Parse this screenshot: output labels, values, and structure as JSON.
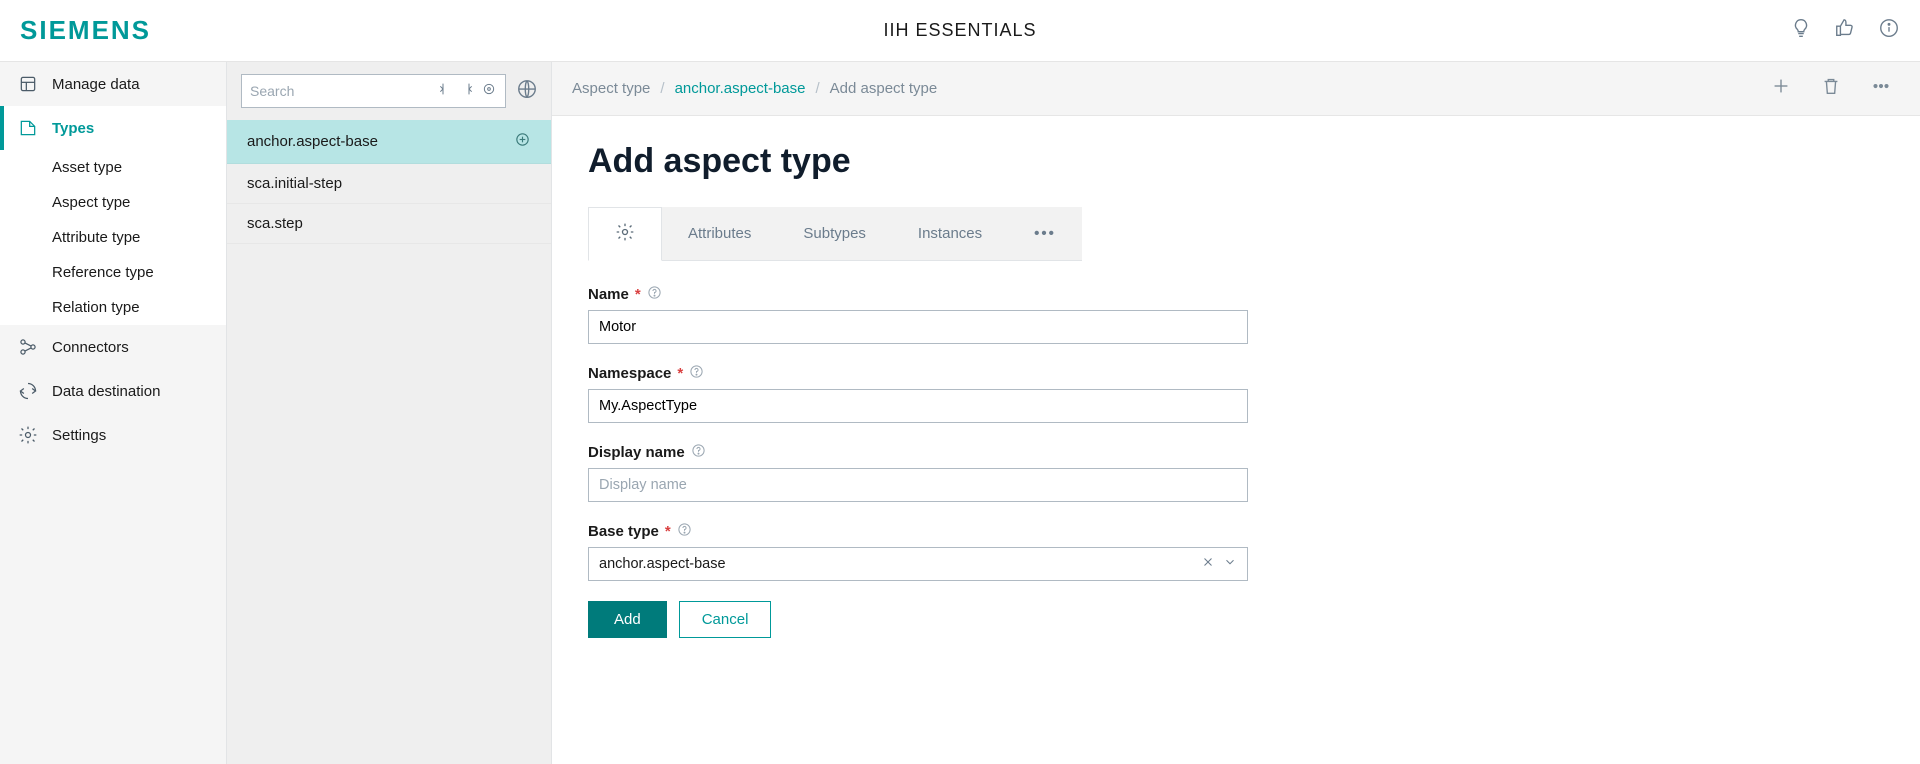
{
  "header": {
    "logo": "SIEMENS",
    "title": "IIH ESSENTIALS"
  },
  "sidebar": {
    "items": [
      {
        "label": "Manage data"
      },
      {
        "label": "Types"
      },
      {
        "label": "Connectors"
      },
      {
        "label": "Data destination"
      },
      {
        "label": "Settings"
      }
    ],
    "types_submenu": [
      {
        "label": "Asset type"
      },
      {
        "label": "Aspect type"
      },
      {
        "label": "Attribute type"
      },
      {
        "label": "Reference type"
      },
      {
        "label": "Relation type"
      }
    ]
  },
  "list_panel": {
    "search_placeholder": "Search",
    "items": [
      {
        "label": "anchor.aspect-base"
      },
      {
        "label": "sca.initial-step"
      },
      {
        "label": "sca.step"
      }
    ]
  },
  "breadcrumb": {
    "a": "Aspect type",
    "b": "anchor.aspect-base",
    "c": "Add aspect type"
  },
  "page": {
    "title": "Add aspect type",
    "tabs": {
      "attributes": "Attributes",
      "subtypes": "Subtypes",
      "instances": "Instances"
    },
    "form": {
      "name_label": "Name",
      "name_value": "Motor",
      "namespace_label": "Namespace",
      "namespace_value": "My.AspectType",
      "display_label": "Display name",
      "display_placeholder": "Display name",
      "basetype_label": "Base type",
      "basetype_value": "anchor.aspect-base",
      "add_btn": "Add",
      "cancel_btn": "Cancel"
    }
  }
}
